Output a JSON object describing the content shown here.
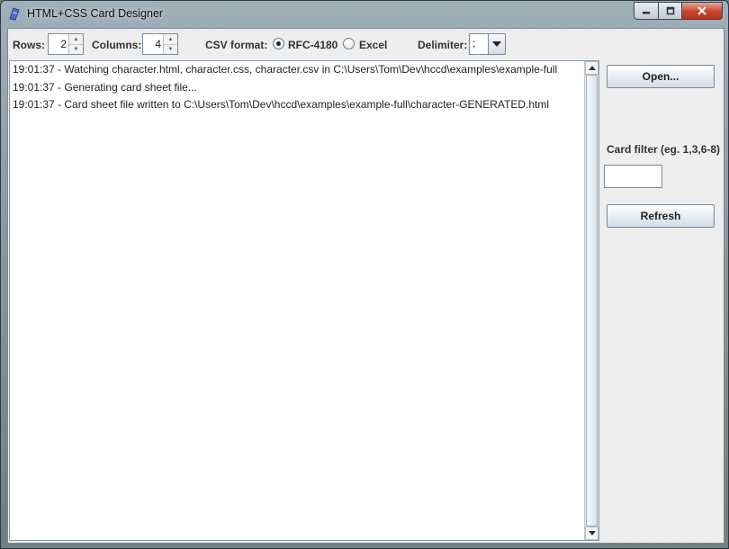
{
  "window": {
    "title": "HTML+CSS Card Designer",
    "icon": "card-designer-icon"
  },
  "toolbar": {
    "rows_label": "Rows:",
    "rows_value": "2",
    "columns_label": "Columns:",
    "columns_value": "4",
    "csv_format_label": "CSV format:",
    "csv_options": [
      {
        "label": "RFC-4180",
        "selected": true
      },
      {
        "label": "Excel",
        "selected": false
      }
    ],
    "delimiter_label": "Delimiter:",
    "delimiter_value": ";"
  },
  "log": {
    "lines": [
      "19:01:37 - Watching character.html, character.css, character.csv in C:\\Users\\Tom\\Dev\\hccd\\examples\\example-full",
      "19:01:37 - Generating card sheet file...",
      "19:01:37 - Card sheet file written to C:\\Users\\Tom\\Dev\\hccd\\examples\\example-full\\character-GENERATED.html"
    ]
  },
  "sidebar": {
    "open_label": "Open...",
    "filter_label": "Card filter (eg. 1,3,6-8)",
    "filter_value": "",
    "refresh_label": "Refresh"
  },
  "colors": {
    "accent": "#1e2a33",
    "close_button": "#c7452c",
    "panel_bg": "#eeeeee"
  }
}
